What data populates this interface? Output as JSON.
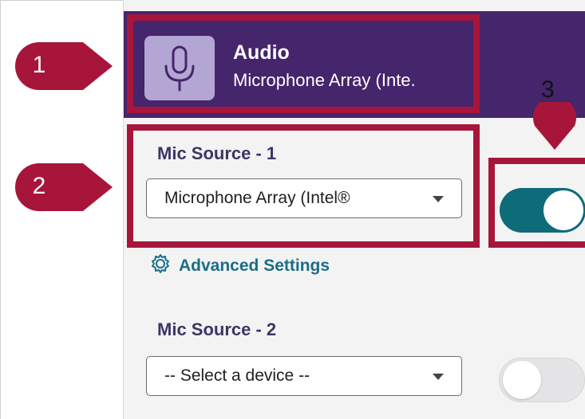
{
  "header": {
    "title": "Audio",
    "subtitle": "Microphone Array (Inte.",
    "icon": "microphone-icon"
  },
  "mic_source_1": {
    "label": "Mic Source - 1",
    "selected_value": "Microphone Array (Intel®",
    "toggle_on": true
  },
  "advanced_settings": {
    "label": "Advanced Settings",
    "icon": "gear-icon"
  },
  "mic_source_2": {
    "label": "Mic Source - 2",
    "selected_value": "-- Select a device --",
    "toggle_on": false
  },
  "callouts": [
    {
      "number": "1"
    },
    {
      "number": "2"
    },
    {
      "number": "3"
    }
  ],
  "colors": {
    "header_bg": "#45256b",
    "callout": "#a7163a",
    "toggle_on": "#0e6b78",
    "link": "#1b6d87"
  }
}
